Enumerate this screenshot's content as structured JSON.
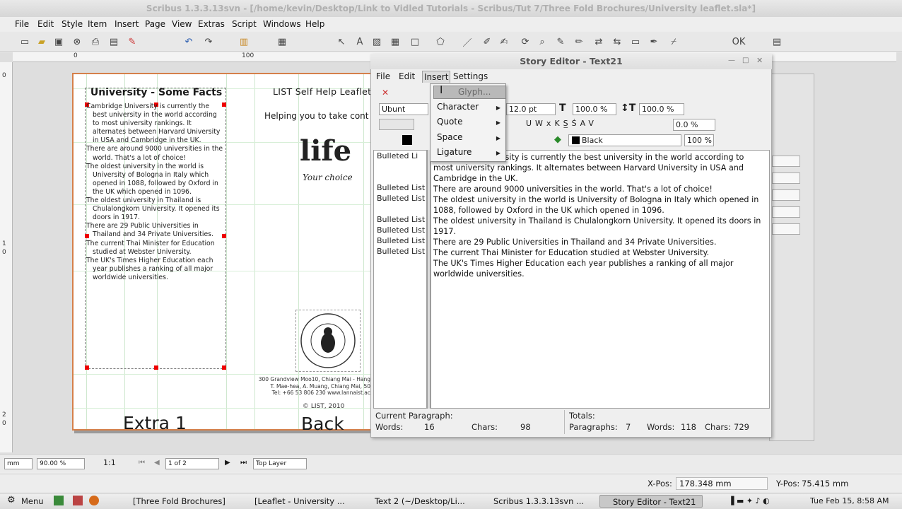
{
  "window": {
    "title": "Scribus 1.3.3.13svn - [/home/kevin/Desktop/Link to Vidled Tutorials - Scribus/Tut 7/Three Fold Brochures/University leaflet.sla*]"
  },
  "menubar": [
    "File",
    "Edit",
    "Style",
    "Item",
    "Insert",
    "Page",
    "View",
    "Extras",
    "Script",
    "Windows",
    "Help"
  ],
  "ruler": {
    "h_labels": [
      "0",
      "100"
    ],
    "v_labels": [
      "0",
      "1",
      "0",
      "2",
      "0"
    ]
  },
  "document": {
    "col1_title": "University - Some Facts",
    "col1_paragraphs": [
      "Cambridge University is currently the best university in the world according to most university rankings. It alternates between Harvard University in USA and Cambridge in the UK.",
      "There are around 9000 universities in the world. That's a lot of choice!",
      "The oldest university in the world is University of Bologna in Italy which opened in 1088, followed by Oxford in the UK which opened in 1096.",
      "The oldest university in Thailand is Chulalongkorn University. It opened its doors in 1917.",
      "There are 29 Public Universities in Thailand and 34 Private Universities.",
      "The current Thai Minister for Education studied at Webster University.",
      "The UK's Times Higher Education each year publishes a ranking of all major worldwide universities."
    ],
    "col2_title": "LIST Self Help Leaflet",
    "col2_sub": "Helping you to take cont",
    "logo_life": "life",
    "logo_choice": "Your choice",
    "school_logo_text": "LANNA INTERNATIONAL SCHOOL THAILAND",
    "address": [
      "300 Grandview Moo10, Chiang Mai - Hang",
      "T. Mae-hea, A. Muang, Chiang Mai, 50",
      "Tel: +66 53 806 230   www.lannaist.ac"
    ],
    "copyright": "© LIST, 2010",
    "footer_left": "Extra 1",
    "footer_right": "Back"
  },
  "navbar": {
    "unit": "mm",
    "zoom": "90.00 %",
    "ratio": "1:1",
    "page": "1 of 2",
    "layer": "Top Layer"
  },
  "statusbar": {
    "xpos_label": "X-Pos:",
    "xpos": "178.348 mm",
    "ypos_label": "Y-Pos:",
    "ypos": "75.415 mm"
  },
  "story_editor": {
    "title": "Story Editor - Text21",
    "menu": [
      "File",
      "Edit",
      "Insert",
      "Settings"
    ],
    "font_field": "Ubunt",
    "size_field": "12.0 pt",
    "scale_h": "100.0 %",
    "scale_v": "100.0 %",
    "tracking": "0.0 %",
    "color": "Black",
    "shade": "100 %",
    "dropdown_items": [
      "Glyph...",
      "Character",
      "Quote",
      "Space",
      "Ligature"
    ],
    "styles_col": [
      "Bulleted Li",
      "Bulleted List",
      "Bulleted List",
      "Bulleted List",
      "Bulleted List",
      "Bulleted List",
      "Bulleted List"
    ],
    "text_lines": [
      "Cambridge University is currently the best university in the world according to most university rankings. It alternates between Harvard University in USA and Cambridge in the UK.",
      "There are around 9000 universities in the world. That's a lot of choice!",
      "The oldest university in the world is University of Bologna in Italy which opened in 1088, followed by Oxford in the UK which opened in 1096.",
      "The oldest university in Thailand is Chulalongkorn University. It opened its doors in 1917.",
      "There are 29 Public Universities in Thailand and 34 Private Universities.",
      "The current Thai Minister for Education studied at Webster University.",
      "The UK's Times Higher Education each year publishes a ranking of all major worldwide universities."
    ],
    "status": {
      "current_paragraph": "Current Paragraph:",
      "words_label": "Words:",
      "words": "16",
      "chars_label": "Chars:",
      "chars": "98",
      "totals": "Totals:",
      "paragraphs_label": "Paragraphs:",
      "paragraphs": "7",
      "total_words_label": "Words:",
      "total_words": "118",
      "total_chars_label": "Chars:",
      "total_chars": "729"
    }
  },
  "taskbar": {
    "menu": "Menu",
    "tasks": [
      "[Three Fold Brochures]",
      "[Leaflet - University ...",
      "Text 2 (~/Desktop/Li...",
      "Scribus 1.3.3.13svn ...",
      "Story Editor - Text21"
    ],
    "clock": "Tue Feb 15,  8:58 AM"
  }
}
